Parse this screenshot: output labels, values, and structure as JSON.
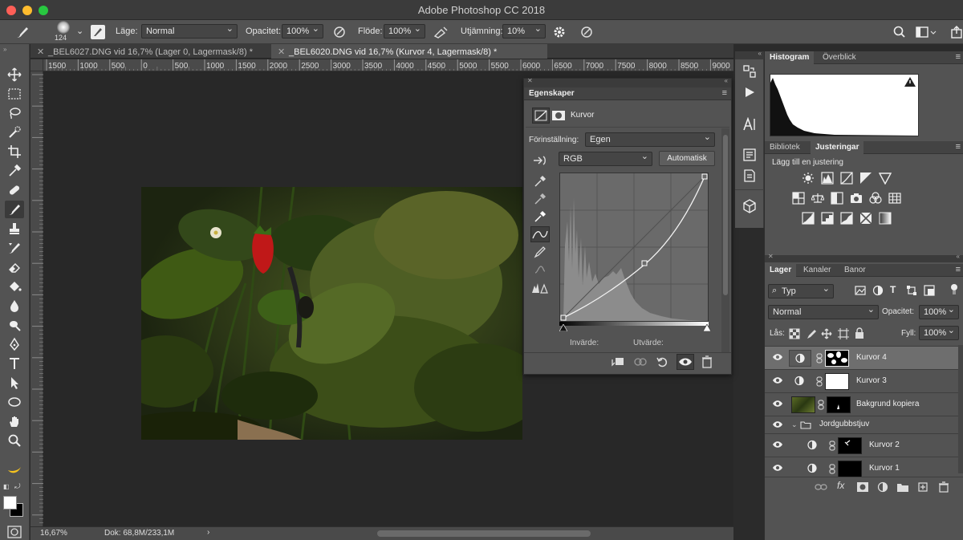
{
  "window": {
    "title": "Adobe Photoshop CC 2018"
  },
  "options_bar": {
    "brush_size": "124",
    "mode_label": "Läge:",
    "mode_value": "Normal",
    "opacity_label": "Opacitet:",
    "opacity_value": "100%",
    "flow_label": "Flöde:",
    "flow_value": "100%",
    "smoothing_label": "Utjämning:",
    "smoothing_value": "10%"
  },
  "tabs": [
    {
      "label": "_BEL6027.DNG vid 16,7% (Lager 0, Lagermask/8) *",
      "active": false
    },
    {
      "label": "_BEL6020.DNG vid 16,7% (Kurvor 4, Lagermask/8) *",
      "active": true
    }
  ],
  "ruler_ticks": [
    "1500",
    "1000",
    "500",
    "0",
    "500",
    "1000",
    "1500",
    "2000",
    "2500",
    "3000",
    "3500",
    "4000",
    "4500",
    "5000",
    "5500",
    "6000",
    "6500",
    "7000",
    "7500",
    "8000",
    "8500",
    "9000"
  ],
  "status": {
    "zoom": "16,67%",
    "doc": "Dok: 68,8M/233,1M"
  },
  "properties": {
    "panel_title": "Egenskaper",
    "adjustment_name": "Kurvor",
    "preset_label": "Förinställning:",
    "preset_value": "Egen",
    "channel_value": "RGB",
    "auto_button": "Automatisk",
    "input_label": "Invärde:",
    "output_label": "Utvärde:"
  },
  "histogram_panel": {
    "tab1": "Histogram",
    "tab2": "Överblick"
  },
  "adjustments_panel": {
    "tab1": "Bibliotek",
    "tab2": "Justeringar",
    "heading": "Lägg till en justering"
  },
  "layers_panel": {
    "tab1": "Lager",
    "tab2": "Kanaler",
    "tab3": "Banor",
    "filter_value": "Typ",
    "blend_value": "Normal",
    "opacity_label": "Opacitet:",
    "opacity_value": "100%",
    "lock_label": "Lås:",
    "fill_label": "Fyll:",
    "fill_value": "100%",
    "layers": [
      {
        "name": "Kurvor 4",
        "selected": true,
        "indent": false
      },
      {
        "name": "Kurvor 3",
        "selected": false,
        "indent": false
      },
      {
        "name": "Bakgrund kopiera",
        "selected": false,
        "indent": false
      },
      {
        "name": "Jordgubbstjuv",
        "selected": false,
        "indent": false,
        "group": true
      },
      {
        "name": "Kurvor 2",
        "selected": false,
        "indent": true
      },
      {
        "name": "Kurvor 1",
        "selected": false,
        "indent": true
      }
    ]
  },
  "colors": {
    "ui_dark": "#2b2b2b",
    "panel": "#535353",
    "selected_row": "#6e6e6e",
    "traffic_red": "#fe5f57",
    "traffic_yellow": "#febc2e",
    "traffic_green": "#28c840"
  }
}
